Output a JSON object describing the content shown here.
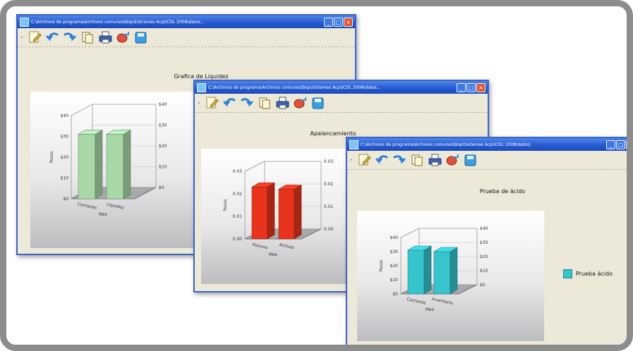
{
  "windows": [
    {
      "title": "C:\\Archivos de programa\\Archivos comunes\\Bop\\Ediciones Acp\\ICDL 2008\\datos...",
      "chart_title": "Grafica de Liquidez",
      "toolbar_icons": [
        "edit-icon",
        "undo-icon",
        "redo-icon",
        "copy-icon",
        "print-icon",
        "export-icon",
        "save-icon"
      ]
    },
    {
      "title": "C:\\Archivos de programa\\Archivos comunes\\Bop\\Sistemas Acp\\ICDL 2008\\datos...",
      "chart_title": "Apalancamiento",
      "toolbar_icons": [
        "edit-icon",
        "undo-icon",
        "redo-icon",
        "copy-icon",
        "print-icon",
        "export-icon",
        "save-icon"
      ]
    },
    {
      "title": "C:\\Archivos de programa\\Archivos comunes\\Bop\\Sistemas Acp\\ICDL 2008\\datos\\",
      "chart_title": "Prueba de ácido",
      "legend_label": "Prueba ácido",
      "toolbar_icons": [
        "edit-icon",
        "undo-icon",
        "redo-icon",
        "copy-icon",
        "print-icon",
        "export-icon",
        "save-icon"
      ]
    }
  ],
  "chart_data": [
    {
      "type": "bar",
      "title": "Grafica de Liquidez",
      "color": "#a8d8a8",
      "categories": [
        "Corriente",
        "Liquidez"
      ],
      "ylabel": "Pesos",
      "xlabel": "Mes",
      "values": [
        0.031,
        0.031
      ],
      "ylim": [
        0,
        0.04
      ],
      "y_ticks": [
        "$0",
        "$10",
        "$20",
        "$30",
        "$40"
      ]
    },
    {
      "type": "bar",
      "title": "Apalancamiento",
      "color": "#e8341c",
      "categories": [
        "Pasivos",
        "Activos"
      ],
      "ylabel": "Pesos",
      "xlabel": "Mes",
      "values": [
        0.023,
        0.022
      ],
      "ylim": [
        0,
        0.03
      ],
      "y_ticks": [
        "0.00",
        "0.01",
        "0.02",
        "0.03"
      ]
    },
    {
      "type": "bar",
      "title": "Prueba de ácido",
      "color": "#36c4cd",
      "categories": [
        "Corriente",
        "Inventario"
      ],
      "ylabel": "Pesos",
      "xlabel": "Mes",
      "series": [
        {
          "name": "Prueba ácido",
          "values": [
            0.031,
            0.03
          ]
        }
      ],
      "ylim": [
        0,
        0.04
      ],
      "y_ticks": [
        "$0",
        "$10",
        "$20",
        "$30",
        "$40"
      ]
    }
  ]
}
